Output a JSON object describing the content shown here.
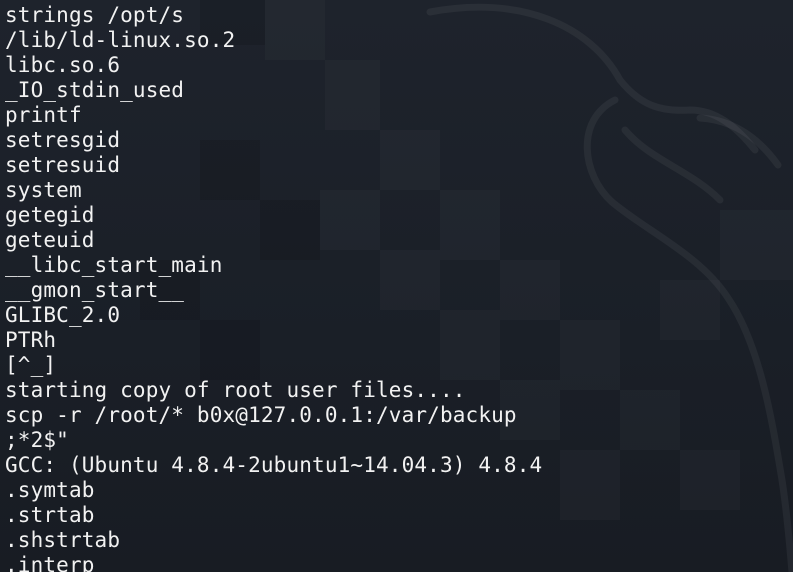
{
  "terminal": {
    "lines": [
      "strings /opt/s",
      "/lib/ld-linux.so.2",
      "libc.so.6",
      "_IO_stdin_used",
      "printf",
      "setresgid",
      "setresuid",
      "system",
      "getegid",
      "geteuid",
      "__libc_start_main",
      "__gmon_start__",
      "GLIBC_2.0",
      "PTRh",
      "[^_]",
      "starting copy of root user files....",
      "scp -r /root/* b0x@127.0.0.1:/var/backup",
      ";*2$\"",
      "GCC: (Ubuntu 4.8.4-2ubuntu1~14.04.3) 4.8.4",
      ".symtab",
      ".strtab",
      ".shstrtab",
      ".interp"
    ]
  },
  "colors": {
    "background": "#1b2029",
    "text": "#f2f2f2"
  },
  "icons": [
    "kali-dragon-wallpaper"
  ]
}
